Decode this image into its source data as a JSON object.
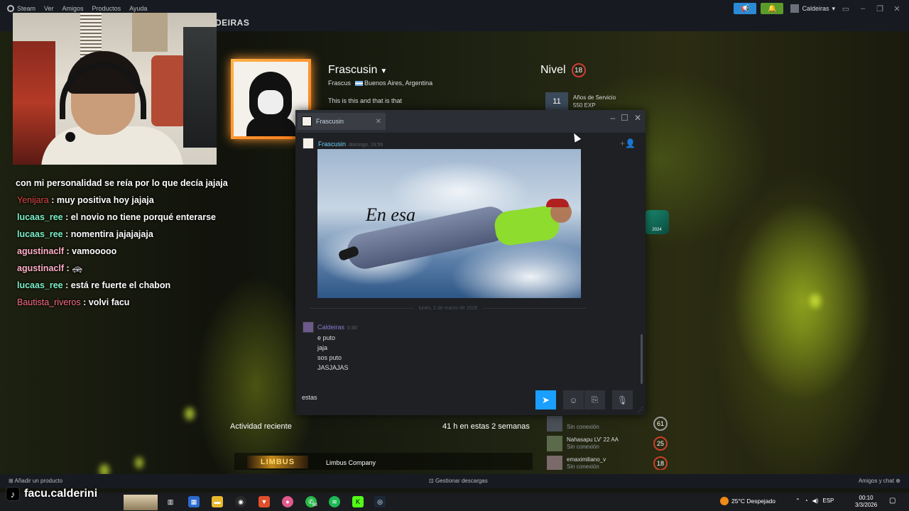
{
  "steam": {
    "menu": [
      "Steam",
      "Ver",
      "Amigos",
      "Productos",
      "Ayuda"
    ],
    "username": "Caldeiras",
    "page_title_fragment": "DEIRAS",
    "bottom": {
      "add_product": "Añadir un producto",
      "downloads": "Gestionar descargas",
      "friends_chat": "Amigos y chat"
    }
  },
  "stream_chat": [
    {
      "user": "",
      "message": "con mi personalidad se reía por lo que decía jajaja",
      "color": "#ffffff"
    },
    {
      "user": "Yenijara",
      "message": ": muy positiva hoy jajaja",
      "color": "#e04848"
    },
    {
      "user": "lucaas_ree",
      "message": ": el novio no tiene porqué enterarse",
      "color": "#7ef0c8"
    },
    {
      "user": "lucaas_ree",
      "message": ": nomentira jajajajaja",
      "color": "#7ef0c8"
    },
    {
      "user": "agustinaclf",
      "message": ": vamooooo",
      "color": "#ffb0c8"
    },
    {
      "user": "agustinaclf",
      "message": ": 🚓",
      "color": "#ffb0c8"
    },
    {
      "user": "lucaas_ree",
      "message": ": está re fuerte el chabon",
      "color": "#7ef0c8"
    },
    {
      "user": "Bautista_riveros",
      "message": ": volvi facu",
      "color": "#ff6a8a"
    }
  ],
  "profile": {
    "name": "Frascusin",
    "real_name": "Frascus",
    "location": "Buenos Aires, Argentina",
    "summary": "This is this and that is that",
    "level_label": "Nivel",
    "level": "18",
    "badge_value": "11",
    "badge_title": "Años de Servicio",
    "badge_exp": "550 EXP",
    "badge_2024": "2024",
    "recent_activity": "Actividad reciente",
    "hours_summary": "41 h en estas 2 semanas",
    "game_logo": "LIMBUS",
    "game_name": "Limbus Company",
    "friends": [
      {
        "name": "",
        "status": "Sin conexión",
        "count": "61"
      },
      {
        "name": "Nahasapu LV' 22 AA",
        "status": "Sin conexión",
        "count": "25"
      },
      {
        "name": "emaximiliano_v",
        "status": "Sin conexión",
        "count": "18"
      }
    ]
  },
  "chat": {
    "tab_label": "Frascusin",
    "sender_1": "Frascusin",
    "time_1": "domingo, 19:56",
    "image_caption": "En esa",
    "date_divider": "lunes, 2 de marzo de 2026",
    "sender_2": "Caldeiras",
    "time_2": "0:30",
    "messages": [
      "e puto",
      "jaja",
      "sos puto",
      "JASJAJAS"
    ],
    "input_value": "estas"
  },
  "taskbar": {
    "whatsapp_badge": "88",
    "weather": "25°C  Despejado",
    "lang": "ESP",
    "time": "00:10",
    "date": "3/3/2026"
  },
  "overlay": {
    "tiktok_handle": "facu.calderini"
  }
}
